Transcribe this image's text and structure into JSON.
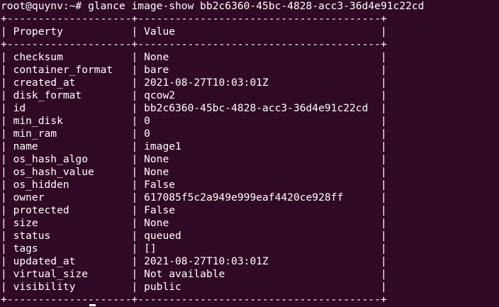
{
  "terminal": {
    "prompt": "root@quynv:~# ",
    "command": "glance image-show bb2c6360-45bc-4828-acc3-36d4e91c22cd",
    "border": "+--------------------+---------------------------------------+",
    "header": "| Property           | Value                                 |",
    "rows": [
      "| checksum           | None                                  |",
      "| container_format   | bare                                  |",
      "| created_at         | 2021-08-27T10:03:01Z                  |",
      "| disk_format        | qcow2                                 |",
      "| id                 | bb2c6360-45bc-4828-acc3-36d4e91c22cd  |",
      "| min_disk           | 0                                     |",
      "| min_ram            | 0                                     |",
      "| name               | image1                                |",
      "| os_hash_algo       | None                                  |",
      "| os_hash_value      | None                                  |",
      "| os_hidden          | False                                 |",
      "| owner              | 617085f5c2a949e999eaf4420ce928ff      |",
      "| protected          | False                                 |",
      "| size               | None                                  |",
      "| status             | queued                                |",
      "| tags               | []                                    |",
      "| updated_at         | 2021-08-27T10:03:01Z                  |",
      "| virtual_size       | Not available                         |",
      "| visibility         | public                                |"
    ]
  },
  "colors": {
    "background": "#300a24",
    "text": "#ffffff"
  }
}
